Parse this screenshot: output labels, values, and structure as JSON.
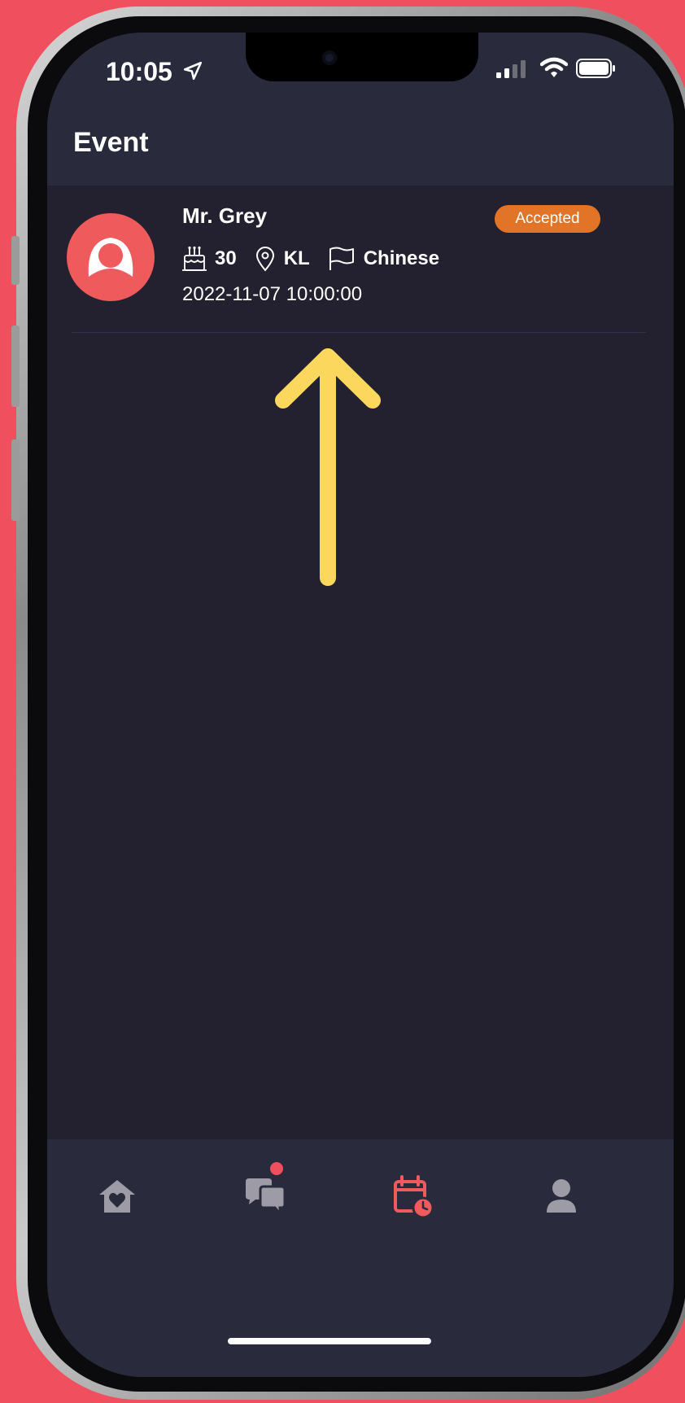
{
  "status_bar": {
    "time": "10:05"
  },
  "header": {
    "title": "Event"
  },
  "event": {
    "name": "Mr. Grey",
    "status": "Accepted",
    "age": "30",
    "location": "KL",
    "language": "Chinese",
    "datetime": "2022-11-07 10:00:00"
  },
  "tabs": [
    {
      "name": "home",
      "icon": "home-heart-icon",
      "active": false
    },
    {
      "name": "messages",
      "icon": "chat-bubbles-icon",
      "active": false,
      "has_badge": true
    },
    {
      "name": "events",
      "icon": "calendar-clock-icon",
      "active": true
    },
    {
      "name": "profile",
      "icon": "person-icon",
      "active": false
    }
  ],
  "colors": {
    "background": "#f0505e",
    "screen": "#23212f",
    "header": "#2a2a3d",
    "accent": "#ef5a5c",
    "badge": "#e27427",
    "annotation": "#fbd85d"
  }
}
